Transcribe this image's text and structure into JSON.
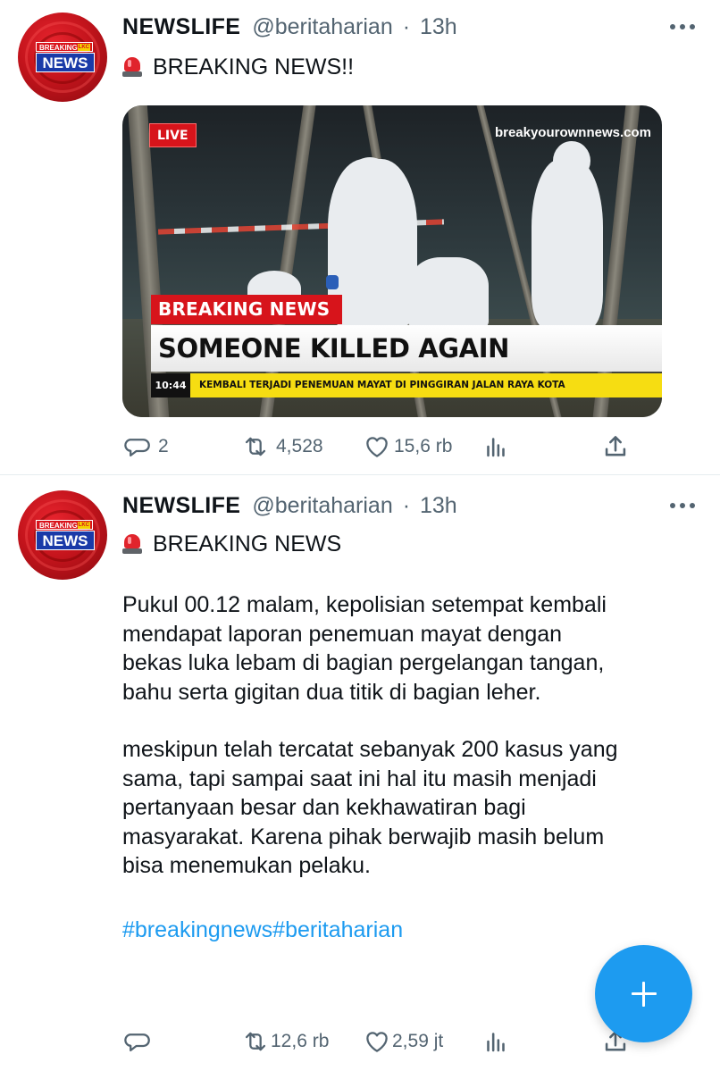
{
  "tweets": [
    {
      "author": {
        "name": "NEWSLIFE",
        "handle": "@beritaharian",
        "time_sep": "·",
        "time": "13h",
        "avatar_text": {
          "top": "BREAKING",
          "tag": "LKC",
          "main": "NEWS"
        }
      },
      "headline_icon": "police-siren-icon",
      "headline": "BREAKING NEWS!!",
      "media": {
        "live_badge": "LIVE",
        "watermark": "breakyourownnews.com",
        "breaking_label": "BREAKING NEWS",
        "main_headline": "SOMEONE KILLED AGAIN",
        "ticker_time": "10:44",
        "ticker_text": "KEMBALI TERJADI PENEMUAN MAYAT DI PINGGIRAN JALAN RAYA KOTA"
      },
      "actions": {
        "reply_count": "2",
        "retweet_count": "4,528",
        "like_count": "15,6 rb"
      }
    },
    {
      "author": {
        "name": "NEWSLIFE",
        "handle": "@beritaharian",
        "time_sep": "·",
        "time": "13h",
        "avatar_text": {
          "top": "BREAKING",
          "tag": "LKC",
          "main": "NEWS"
        }
      },
      "headline_icon": "police-siren-icon",
      "headline": "BREAKING NEWS",
      "paragraphs": [
        "Pukul 00.12 malam, kepolisian setempat kembali\nmendapat laporan penemuan mayat dengan\nbekas luka lebam di bagian pergelangan tangan,\nbahu serta  gigitan dua titik di bagian leher.",
        "meskipun telah tercatat sebanyak 200 kasus yang\nsama, tapi sampai saat ini hal itu masih menjadi\npertanyaan besar dan kekhawatiran bagi\nmasyarakat. Karena pihak berwajib masih belum\nbisa menemukan pelaku."
      ],
      "hashtags": "#breakingnews#beritaharian",
      "actions": {
        "reply_count": "",
        "retweet_count": "12,6 rb",
        "like_count": "2,59 jt"
      }
    }
  ],
  "colors": {
    "accent": "#1d9bf0",
    "muted": "#536471",
    "text": "#0f1419",
    "brand_red": "#d7141b"
  },
  "fab": {
    "icon": "plus-icon"
  }
}
